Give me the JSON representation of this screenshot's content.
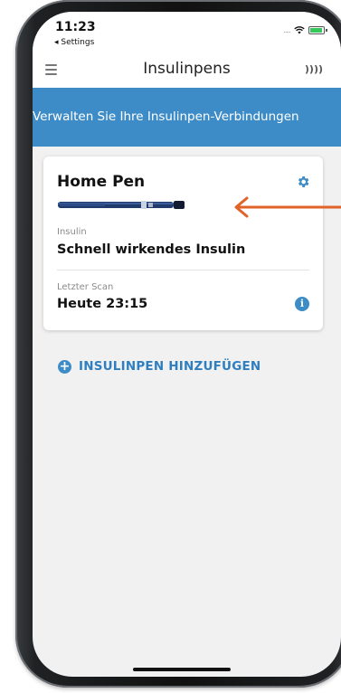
{
  "status_bar": {
    "time": "11:23",
    "back_label": "◂ Settings",
    "signal": "....."
  },
  "header": {
    "title": "Insulinpens",
    "nfc_symbol": "))))"
  },
  "banner": {
    "text": "Verwalten Sie Ihre Insulinpen-Verbindungen"
  },
  "pen_card": {
    "name": "Home Pen",
    "insulin_label": "Insulin",
    "insulin_value": "Schnell wirkendes Insulin",
    "last_scan_label": "Letzter Scan",
    "last_scan_value": "Heute 23:15"
  },
  "actions": {
    "add_pen_label": "INSULINPEN HINZUFÜGEN"
  },
  "icons": {
    "menu": "hamburger-menu-icon",
    "nfc": "nfc-icon",
    "settings": "gear-icon",
    "info": "info-icon",
    "add": "plus-circle-icon"
  },
  "colors": {
    "accent": "#3d8cc7",
    "annotation_arrow": "#e0632a"
  }
}
